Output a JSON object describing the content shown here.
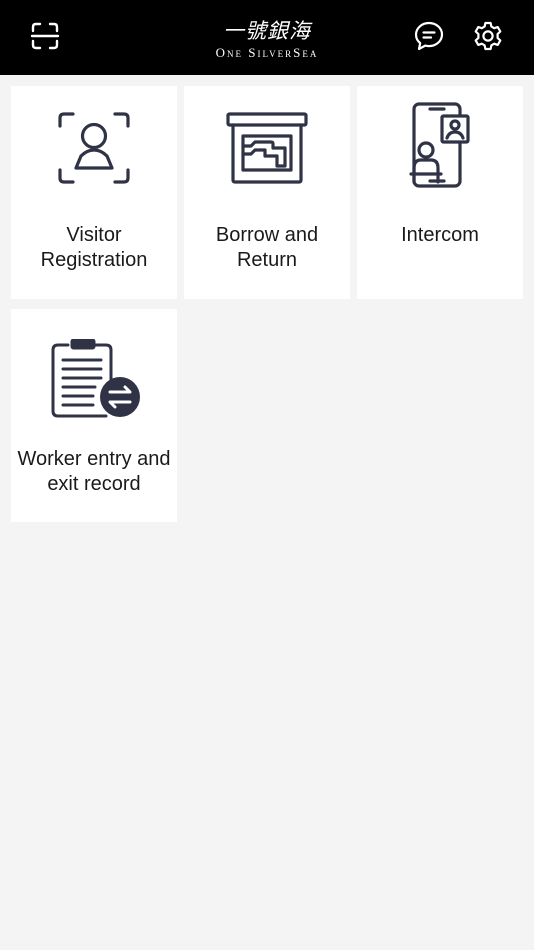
{
  "header": {
    "logo_cn": "一號銀海",
    "logo_en": "One SilverSea",
    "scan_icon": "scan-icon",
    "message_icon": "chat-bubble-icon",
    "settings_icon": "gear-icon"
  },
  "menu": {
    "items": [
      {
        "label": "Visitor Registration",
        "icon": "visitor-id-icon"
      },
      {
        "label": "Borrow and Return",
        "icon": "storage-box-icon"
      },
      {
        "label": "Intercom",
        "icon": "video-intercom-icon"
      },
      {
        "label": "Worker entry and exit record",
        "icon": "clipboard-transfer-icon"
      }
    ]
  },
  "colors": {
    "header_bg": "#000000",
    "page_bg": "#f4f4f4",
    "card_bg": "#ffffff",
    "icon_stroke": "#2f3345"
  }
}
